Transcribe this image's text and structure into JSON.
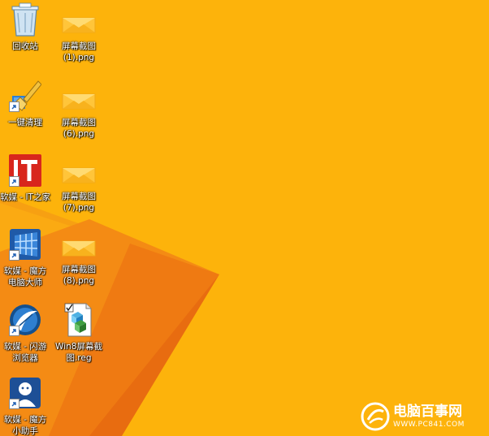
{
  "desktop": {
    "background_color": "#FDB30B",
    "accent_color": "#F07A10",
    "icons": [
      {
        "label": "回收站",
        "icon": "recycle-bin-icon"
      },
      {
        "label": "屏幕截图\n(1).png",
        "icon": "png-image-icon"
      },
      {
        "label": "一键清理",
        "icon": "broom-cleaner-icon"
      },
      {
        "label": "屏幕截图\n(6).png",
        "icon": "png-image-icon"
      },
      {
        "label": "软媒 - IT之家",
        "icon": "ithome-icon"
      },
      {
        "label": "屏幕截图\n(7).png",
        "icon": "png-image-icon"
      },
      {
        "label": "软媒 - 魔方\n电脑大师",
        "icon": "mofang-master-icon"
      },
      {
        "label": "屏幕截图\n(8).png",
        "icon": "png-image-icon"
      },
      {
        "label": "软媒 - 闪游\n浏览器",
        "icon": "shanyou-browser-icon"
      },
      {
        "label": "Win8屏幕截\n图.reg",
        "icon": "reg-file-icon"
      },
      {
        "label": "软媒 - 魔方\n小助手",
        "icon": "mofang-helper-icon"
      }
    ]
  },
  "watermark": {
    "title": "电脑百事网",
    "url": "WWW.PC841.COM"
  }
}
